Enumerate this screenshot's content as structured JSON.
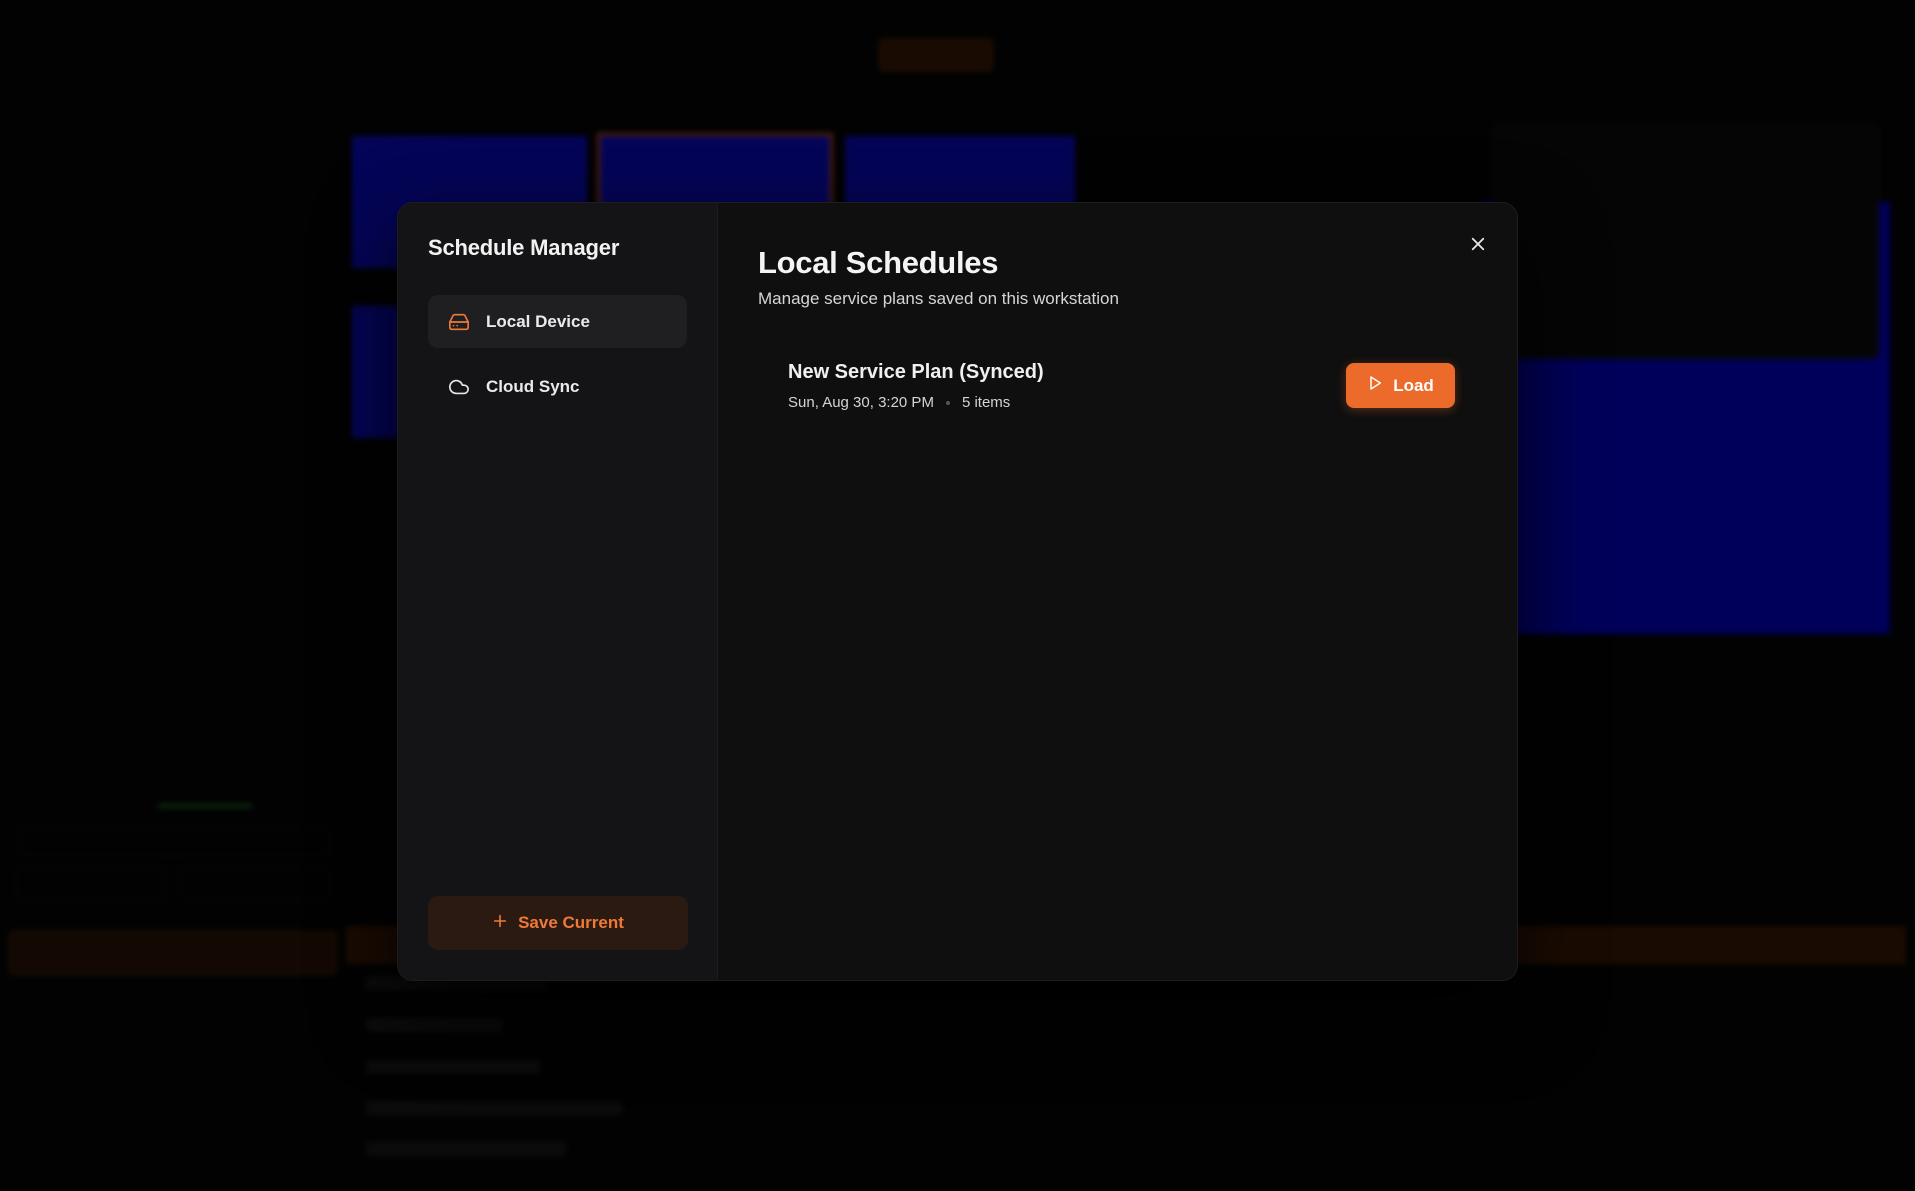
{
  "modal": {
    "title": "Schedule Manager",
    "nav": [
      {
        "label": "Local Device",
        "icon": "hard-drive-icon",
        "active": true
      },
      {
        "label": "Cloud Sync",
        "icon": "cloud-icon",
        "active": false
      }
    ],
    "save_label": "Save Current",
    "main_title": "Local Schedules",
    "main_subtitle": "Manage service plans saved on this workstation",
    "schedules": [
      {
        "name": "New Service Plan (Synced)",
        "date": "Sun, Aug 30, 3:20 PM",
        "count": "5 items",
        "load_label": "Load"
      }
    ]
  },
  "colors": {
    "accent": "#ec6a2a",
    "modal_bg": "#0f0f0f",
    "sidebar_bg": "#141416",
    "slide_blue": "#0b0bc4"
  }
}
